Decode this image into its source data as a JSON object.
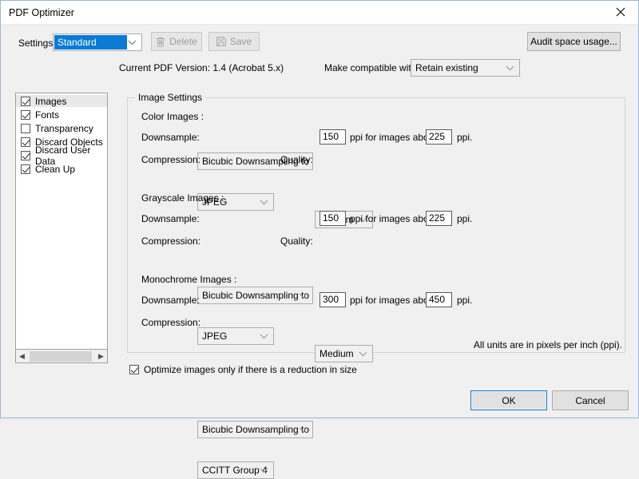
{
  "window": {
    "title": "PDF Optimizer",
    "close_icon": "close-icon"
  },
  "toolbar": {
    "settings_label": "Settings:",
    "settings_value": "Standard",
    "delete_label": "Delete",
    "delete_icon": "trash-icon",
    "save_label": "Save",
    "save_icon": "floppy-disk-icon",
    "audit_label": "Audit space usage...",
    "pdf_version": "Current PDF Version: 1.4 (Acrobat 5.x)",
    "compat_label": "Make compatible with:",
    "compat_value": "Retain existing"
  },
  "sidebar": {
    "items": [
      {
        "label": "Images",
        "checked": true,
        "selected": true
      },
      {
        "label": "Fonts",
        "checked": true,
        "selected": false
      },
      {
        "label": "Transparency",
        "checked": false,
        "selected": false
      },
      {
        "label": "Discard Objects",
        "checked": true,
        "selected": false
      },
      {
        "label": "Discard User Data",
        "checked": true,
        "selected": false
      },
      {
        "label": "Clean Up",
        "checked": true,
        "selected": false
      }
    ],
    "scroll_left_icon": "chevron-left-icon",
    "scroll_right_icon": "chevron-right-icon"
  },
  "image_settings": {
    "group_title": "Image Settings",
    "labels": {
      "downsample": "Downsample:",
      "compression": "Compression:",
      "quality": "Quality:",
      "ppi_above": "ppi for images above",
      "ppi": "ppi."
    },
    "color": {
      "section_title": "Color Images :",
      "downsample_method": "Bicubic Downsampling to",
      "downsample_ppi": "150",
      "threshold_ppi": "225",
      "compression": "JPEG",
      "quality": "Medium"
    },
    "grayscale": {
      "section_title": "Grayscale Images :",
      "downsample_method": "Bicubic Downsampling to",
      "downsample_ppi": "150",
      "threshold_ppi": "225",
      "compression": "JPEG",
      "quality": "Medium"
    },
    "monochrome": {
      "section_title": "Monochrome Images :",
      "downsample_method": "Bicubic Downsampling to",
      "downsample_ppi": "300",
      "threshold_ppi": "450",
      "compression": "CCITT Group 4"
    },
    "units_note": "All units are in pixels per inch (ppi)."
  },
  "footer": {
    "optimize_checkbox_label": "Optimize images only if there is a reduction in size",
    "optimize_checked": true,
    "ok_label": "OK",
    "cancel_label": "Cancel"
  },
  "colors": {
    "accent": "#0a7ad4",
    "window_bg": "#f0f0f0",
    "field_bg": "#ffffff"
  }
}
